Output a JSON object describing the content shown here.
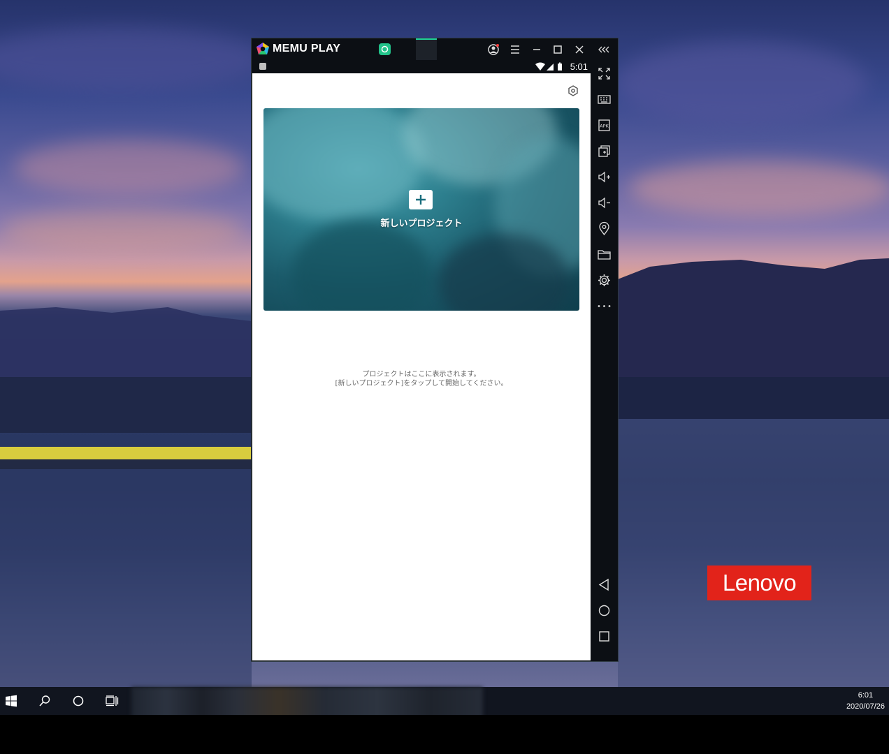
{
  "desktop": {
    "brand_logo": "Lenovo"
  },
  "emulator": {
    "app_name": "MEMU PLAY",
    "title_buttons": [
      "account-icon",
      "menu-icon",
      "minimize-icon",
      "maximize-icon",
      "close-icon",
      "collapse-sidebar-icon"
    ],
    "status_bar": {
      "time": "5:01",
      "icons": [
        "wifi-icon",
        "signal-icon",
        "battery-icon"
      ]
    },
    "app": {
      "new_project_label": "新しいプロジェクト",
      "empty_line1": "プロジェクトはここに表示されます。",
      "empty_line2": "[新しいプロジェクト]をタップして開始してください。"
    },
    "sidebar_buttons": [
      "fullscreen-icon",
      "keyboard-icon",
      "apk-icon",
      "multi-instance-icon",
      "volume-up-icon",
      "volume-down-icon",
      "location-icon",
      "folder-icon",
      "settings-icon",
      "more-icon",
      "back-icon",
      "home-icon",
      "recents-icon"
    ],
    "accent_color": "#1fd29c"
  },
  "taskbar": {
    "clock_time": "6:01",
    "clock_date": "2020/07/26",
    "icons": [
      "windows-start-icon",
      "search-icon",
      "cortana-icon",
      "task-view-icon"
    ]
  }
}
